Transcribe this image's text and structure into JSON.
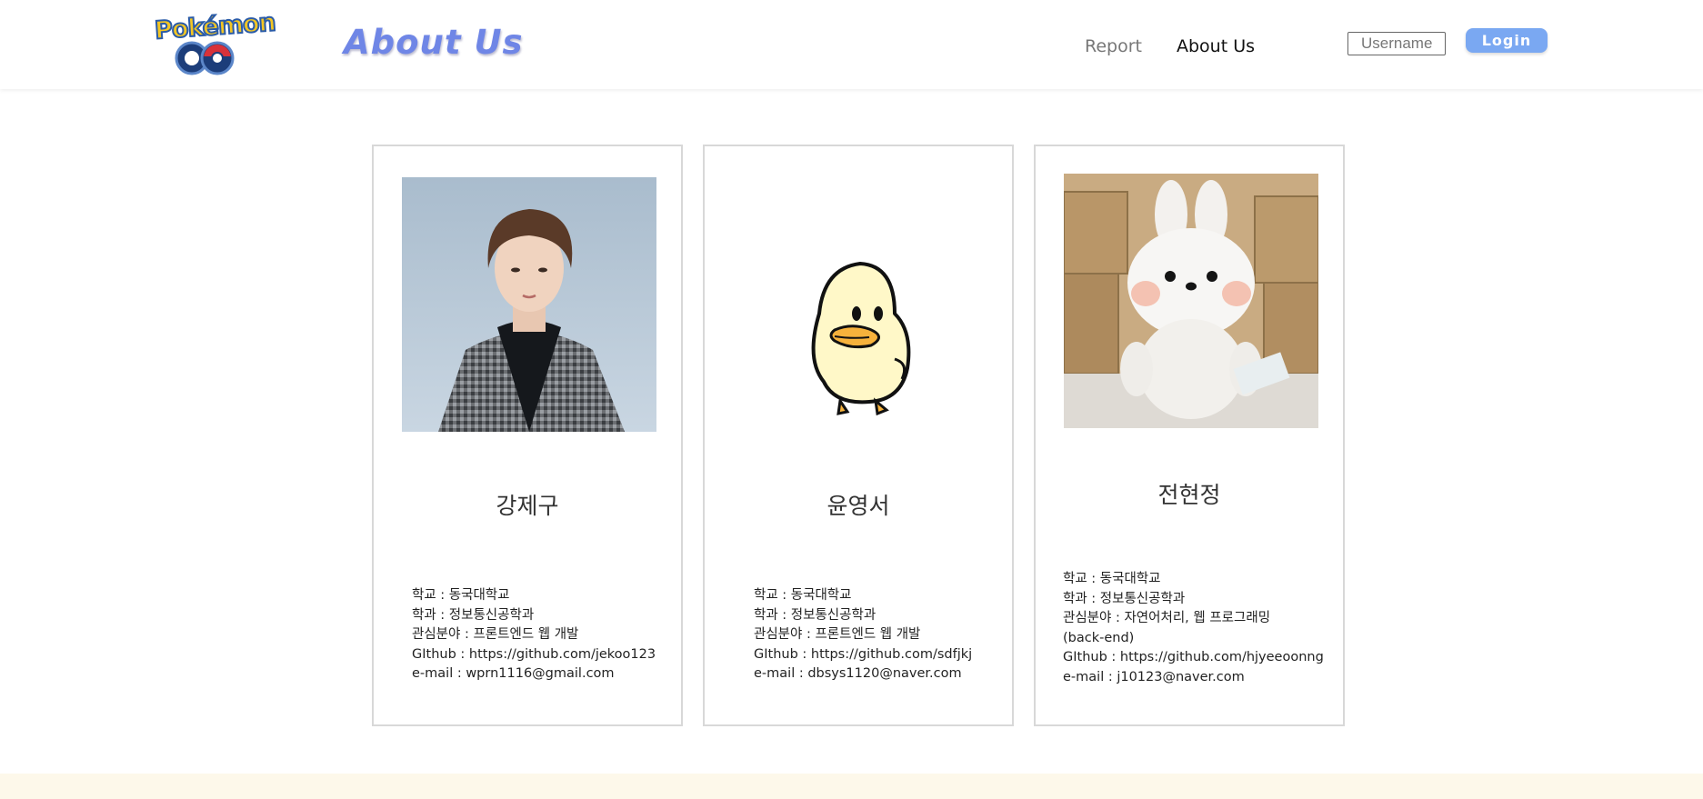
{
  "header": {
    "logo_text_top": "Pokémon",
    "logo_text_bottom": "GO",
    "page_title": "About Us",
    "nav": {
      "report_label": "Report",
      "about_label": "About Us"
    },
    "username_placeholder": "Username",
    "login_label": "Login"
  },
  "colors": {
    "accent": "#6f86e6",
    "login_button": "#7aa8f2",
    "footer_band": "#fdf8ea"
  },
  "members": [
    {
      "name": "강제구",
      "photo": "portrait-photo",
      "info": [
        "학교 : 동국대학교",
        "학과 : 정보통신공학과",
        "관심분야 : 프론트엔드 웹 개발",
        "GIthub : https://github.com/jekoo123",
        "e-mail :    wprn1116@gmail.com"
      ]
    },
    {
      "name": "윤영서",
      "photo": "duck-illustration",
      "info": [
        "학교 : 동국대학교",
        "학과 : 정보통신공학과",
        "관심분야 : 프론트엔드 웹 개발",
        "GIthub : https://github.com/sdfjkj",
        "e-mail :    dbsys1120@naver.com"
      ]
    },
    {
      "name": "전현정",
      "photo": "plush-rabbit-photo",
      "info": [
        "학교 : 동국대학교",
        "학과 : 정보통신공학과",
        "관심분야 : 자연어처리, 웹 프로그래밍",
        "(back-end)",
        "GIthub : https://github.com/hjyeeoonng",
        "e-mail :    j10123@naver.com"
      ]
    }
  ]
}
